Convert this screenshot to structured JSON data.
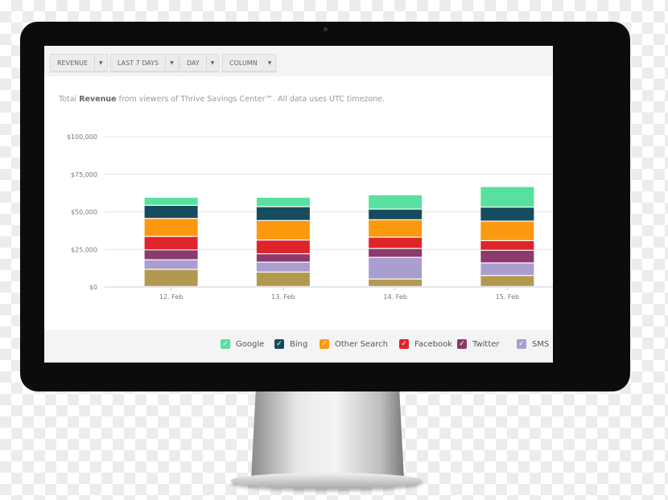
{
  "toolbar": {
    "dropdowns": [
      {
        "label": "REVENUE"
      },
      {
        "label": "LAST 7 DAYS"
      },
      {
        "label": "DAY"
      },
      {
        "label": "COLUMN"
      }
    ],
    "caret": "▼"
  },
  "subtitle": {
    "prefix": "Total ",
    "bold": "Revenue",
    "suffix": " from viewers of Thrive Savings Center™. All data uses UTC timezone."
  },
  "chart_data": {
    "type": "bar",
    "stacked": true,
    "categories": [
      "12. Feb",
      "13. Feb",
      "14. Feb",
      "15. Feb"
    ],
    "ylim": [
      0,
      100000
    ],
    "yticks": [
      0,
      25000,
      50000,
      75000,
      100000
    ],
    "ytick_labels": [
      "$0",
      "$25,000",
      "$50,000",
      "$75,000",
      "$100,000"
    ],
    "grid": true,
    "legend_position": "bottom-right",
    "series": [
      {
        "values": [
          11400,
          9600,
          5000,
          7300
        ],
        "color": "#b19a4f"
      },
      {
        "name": "SMS",
        "values": [
          6400,
          6600,
          14400,
          8400
        ],
        "color": "#aa9dd0"
      },
      {
        "name": "Twitter",
        "values": [
          6600,
          5600,
          5900,
          8400
        ],
        "color": "#8b3a6b"
      },
      {
        "name": "Facebook",
        "values": [
          8900,
          9100,
          7500,
          6400
        ],
        "color": "#e0242c"
      },
      {
        "name": "Other Search",
        "values": [
          12000,
          13000,
          11600,
          13000
        ],
        "color": "#fb9a0e"
      },
      {
        "name": "Bing",
        "values": [
          8700,
          9200,
          7100,
          9300
        ],
        "color": "#174c5e"
      },
      {
        "name": "Google",
        "values": [
          5400,
          6300,
          9500,
          13700
        ],
        "color": "#58e09e"
      }
    ]
  },
  "legend": {
    "items": [
      {
        "label": "Google",
        "color": "#58e09e"
      },
      {
        "label": "Bing",
        "color": "#174c5e"
      },
      {
        "label": "Other Search",
        "color": "#fb9a0e"
      },
      {
        "label": "Facebook",
        "color": "#e0242c"
      },
      {
        "label": "Twitter",
        "color": "#8b3a6b"
      },
      {
        "label": "SMS",
        "color": "#aa9dd0"
      }
    ],
    "check": "✓"
  }
}
